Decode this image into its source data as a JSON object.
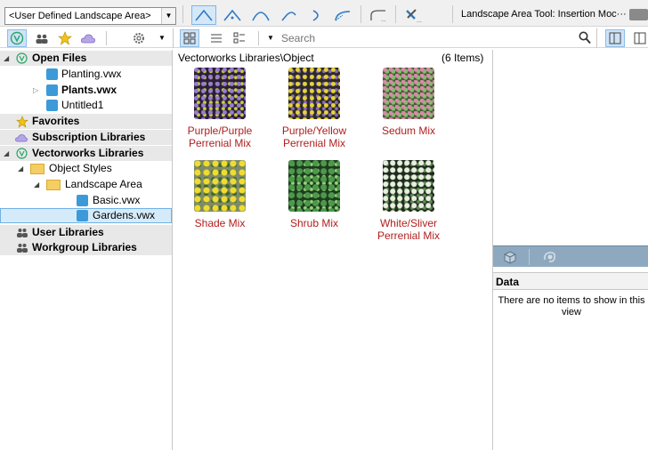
{
  "toolbar": {
    "class_dropdown": "<User Defined Landscape Area>",
    "mode_label": "Landscape Area Tool: Insertion Moc···",
    "tools": [
      "corner-vertex-icon",
      "bezier-vertex-icon",
      "cubic-vertex-icon",
      "tangent-arc-icon",
      "point-on-arc-icon",
      "arc-by-radius-icon",
      "rectangle-mode-icon",
      "preferences-icon"
    ]
  },
  "row2": {
    "search_placeholder": "Search"
  },
  "tree": {
    "open_files": "Open Files",
    "planting": "Planting.vwx",
    "plants": "Plants.vwx",
    "untitled": "Untitled1",
    "favorites": "Favorites",
    "subscription": "Subscription Libraries",
    "vectorworks": "Vectorworks Libraries",
    "object_styles": "Object Styles",
    "landscape_area": "Landscape Area",
    "basic": "Basic.vwx",
    "gardens": "Gardens.vwx",
    "user": "User Libraries",
    "workgroup": "Workgroup Libraries"
  },
  "center": {
    "breadcrumb": "Vectorworks Libraries\\Object",
    "count": "(6 Items)",
    "items": [
      {
        "name_line1": "Purple/Purple",
        "name_line2": "Perrenial Mix"
      },
      {
        "name_line1": "Purple/Yellow",
        "name_line2": "Perrenial Mix"
      },
      {
        "name_line1": "Sedum Mix",
        "name_line2": ""
      },
      {
        "name_line1": "Shade Mix",
        "name_line2": ""
      },
      {
        "name_line1": "Shrub Mix",
        "name_line2": ""
      },
      {
        "name_line1": "White/Sliver",
        "name_line2": "Perrenial Mix"
      }
    ]
  },
  "right": {
    "data_title": "Data",
    "empty_line1": "There are no items to show in this",
    "empty_line2": "view"
  },
  "colors": {
    "item_text": "#b01e1e",
    "accent": "#2e8bd6",
    "selection": "#d6ebfa"
  }
}
